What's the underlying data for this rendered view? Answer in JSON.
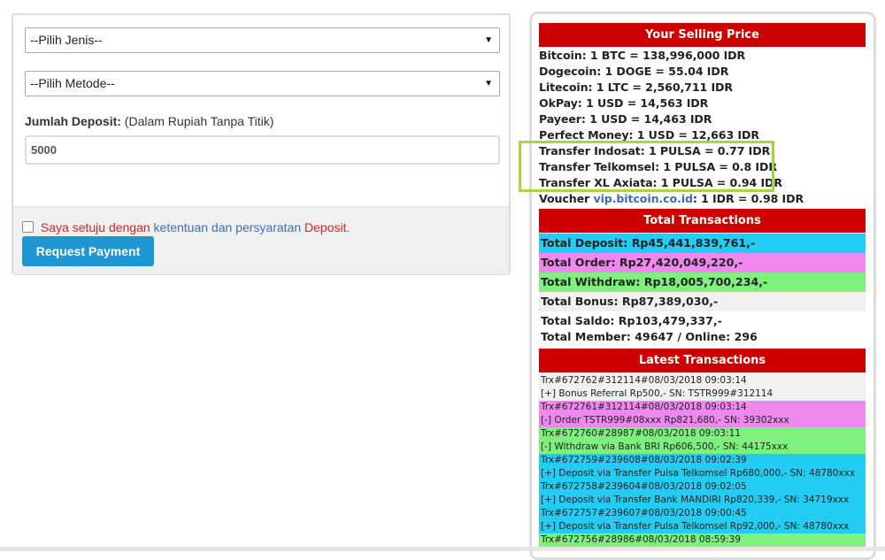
{
  "form": {
    "jenis_select": "--Pilih Jenis--",
    "metode_select": "--Pilih Metode--",
    "amount_label": "Jumlah Deposit:",
    "amount_hint": "(Dalam Rupiah Tanpa Titik)",
    "amount_value": "5000",
    "agree_prefix": "Saya setuju dengan",
    "agree_link": "ketentuan dan persyaratan",
    "agree_suffix": "Deposit.",
    "submit_label": "Request Payment"
  },
  "selling_price": {
    "title": "Your Selling Price",
    "lines": [
      "Bitcoin: 1 BTC = 138,996,000 IDR",
      "Dogecoin: 1 DOGE = 55.04 IDR",
      "Litecoin: 1 LTC = 2,560,711 IDR",
      "OkPay: 1 USD = 14,563 IDR",
      "Payeer: 1 USD = 14,463 IDR",
      "Perfect Money: 1 USD = 12,663 IDR",
      "Transfer Indosat: 1 PULSA = 0.77 IDR",
      "Transfer Telkomsel: 1 PULSA = 0.8 IDR",
      "Transfer XL Axiata: 1 PULSA = 0.94 IDR"
    ],
    "voucher_prefix": "Voucher",
    "voucher_link": "vip.bitcoin.co.id",
    "voucher_suffix": ": 1 IDR = 0.98 IDR"
  },
  "totals": {
    "title": "Total Transactions",
    "deposit": "Total Deposit: Rp45,441,839,761,-",
    "order": "Total Order: Rp27,420,049,220,-",
    "withdraw": "Total Withdraw: Rp18,005,700,234,-",
    "bonus": "Total Bonus: Rp87,389,030,-",
    "saldo": "Total Saldo: Rp103,479,337,-",
    "member": "Total Member: 49647 / Online: 296"
  },
  "latest": {
    "title": "Latest Transactions",
    "rows": [
      {
        "line1": "Trx#672762#312114#08/03/2018 09:03:14",
        "line2": "[+] Bonus Referral Rp500,- SN: TSTR999#312114",
        "color": "#f0f0f0"
      },
      {
        "line1": "Trx#672761#312114#08/03/2018 09:03:14",
        "line2": "[-] Order TSTR999#08xxx Rp821,680,- SN: 39302xxx",
        "color": "#ee88ee"
      },
      {
        "line1": "Trx#672760#28987#08/03/2018 09:03:11",
        "line2": "[-] Withdraw via Bank BRI Rp606,500,- SN: 44175xxx",
        "color": "#7ef07e"
      },
      {
        "line1": "Trx#672759#239608#08/03/2018 09:02:39",
        "line2": "[+] Deposit via Transfer Pulsa Telkomsel Rp680,000,- SN: 48780xxx",
        "color": "#22ccf2"
      },
      {
        "line1": "Trx#672758#239604#08/03/2018 09:02:05",
        "line2": "[+] Deposit via Transfer Bank MANDIRI Rp820,339,- SN: 34719xxx",
        "color": "#22ccf2"
      },
      {
        "line1": "Trx#672757#239607#08/03/2018 09:00:45",
        "line2": "[+] Deposit via Transfer Pulsa Telkomsel Rp92,000,- SN: 48780xxx",
        "color": "#22ccf2"
      },
      {
        "line1": "Trx#672756#28986#08/03/2018 08:59:39",
        "line2": "",
        "color": "#7ef07e"
      }
    ]
  },
  "colors": {
    "header_red": "#cc0000",
    "deposit_cyan": "#22ccf2",
    "order_pink": "#ee88ee",
    "withdraw_green": "#7ef07e",
    "button_blue": "#1e96d2",
    "highlight_green": "#a6d640"
  }
}
